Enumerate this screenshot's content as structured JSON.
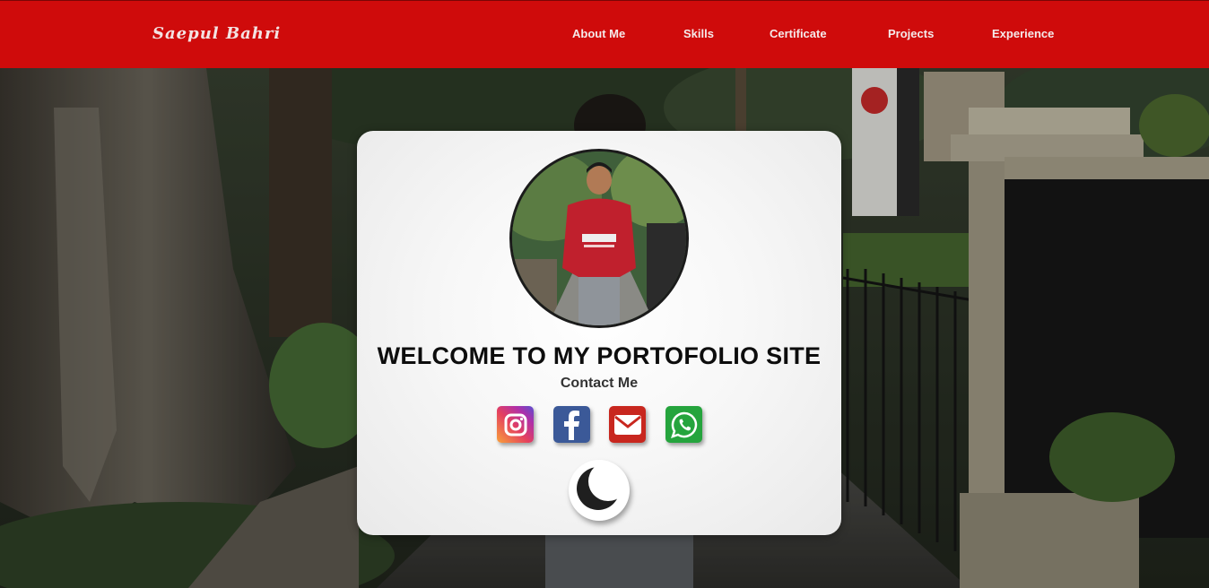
{
  "navbar": {
    "brand": "Saepul Bahri",
    "links": [
      "About Me",
      "Skills",
      "Certificate",
      "Projects",
      "Experience"
    ]
  },
  "hero": {
    "welcome": "WELCOME TO MY PORTOFOLIO SITE",
    "contact_label": "Contact Me",
    "socials": [
      "instagram-icon",
      "facebook-icon",
      "mail-icon",
      "whatsapp-icon"
    ],
    "theme_toggle_icon": "moon-icon"
  },
  "colors": {
    "navbar": "#cf0b0b",
    "instagram": "#c13584",
    "facebook": "#3b5998",
    "mail": "#c8271f",
    "whatsapp": "#25a43d"
  }
}
